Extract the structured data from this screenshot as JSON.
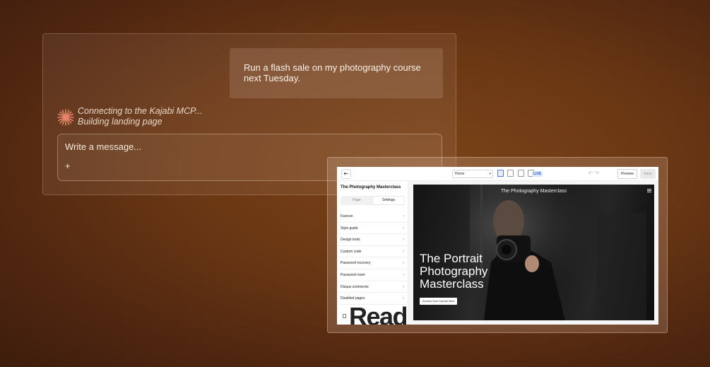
{
  "chat": {
    "user_message": "Run a flash sale on my photography course next Tuesday.",
    "status_lines": [
      "Connecting to the Kajabi MCP...",
      "Building landing page"
    ],
    "composer": {
      "placeholder": "Write a message...",
      "add_label": "+"
    }
  },
  "editor": {
    "topbar": {
      "page_select": "Home",
      "live_badge": "LIVE",
      "preview_label": "Preview",
      "save_label": "Save"
    },
    "sidebar": {
      "site_title": "The Photography Masterclass",
      "tabs": [
        "Page",
        "Settings"
      ],
      "active_tab": "Settings",
      "menu_items": [
        "Favicon",
        "Style guide",
        "Design tools",
        "Custom code",
        "Password recovery",
        "Password reset",
        "Disqus comments",
        "Disabled pages"
      ],
      "big_word": "Read"
    },
    "hero": {
      "bar_title": "The Photography Masterclass",
      "headline": "The Portrait Photography Masterclass",
      "cta_label": "Access Your Course Now"
    }
  },
  "colors": {
    "background": "#6a3714",
    "accent_spark": "#e8836a",
    "live_badge": "#2f5bd8"
  }
}
